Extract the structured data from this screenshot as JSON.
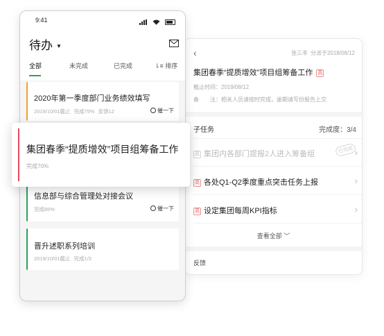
{
  "detail": {
    "back_icon": "chevron-left-icon",
    "owner": "张三丰",
    "source": "分派于2018/08/12",
    "title": "集团春季“提质增效”项目组筹备工作",
    "priority_tag": "高",
    "deadline": "截止时间：2019/08/12",
    "note": "备　　注：相关人员请按时完成，逾期请写份报告上交",
    "subtasks_label": "子任务",
    "completion": "完成度：3/4",
    "subtasks": [
      {
        "tag": "高",
        "label": "集团内各部门提报2人进入筹备组",
        "done": true,
        "stamp": "已完成"
      },
      {
        "tag": "高",
        "label": "各处Q1-Q2季度重点突击任务上报",
        "done": false
      },
      {
        "tag": "高",
        "label": "设定集团每周KPI指标",
        "done": false
      }
    ],
    "view_all": "查看全部 ﹀",
    "feedback": "反馈"
  },
  "phone": {
    "status_time": "9:41",
    "title": "待办",
    "title_caret": "▼",
    "tabs": [
      {
        "label": "全部",
        "active": true
      },
      {
        "label": "未完成",
        "active": false
      },
      {
        "label": "已完成",
        "active": false
      },
      {
        "label": "⇂≡ 排序",
        "active": false
      }
    ],
    "tasks": [
      {
        "title": "2020年第一季度部门业务绩效填写",
        "date": "2019/10/01截止",
        "progress": "完成75%",
        "feedback": "反馈12",
        "urge": "催一下",
        "color": "#f0a030"
      },
      {
        "title": "信息部与综合管理处对接会议",
        "progress": "完成85%",
        "urge": "催一下",
        "color": "#2aa15a"
      },
      {
        "title": "晋升述职系列培训",
        "date": "2019/10/01截止",
        "progress": "完成1/3",
        "color": "#2aa15a"
      }
    ]
  },
  "highlight": {
    "title": "集团春季“提质增效”项目组筹备工作",
    "progress": "完成70%",
    "color": "#e8475b"
  }
}
